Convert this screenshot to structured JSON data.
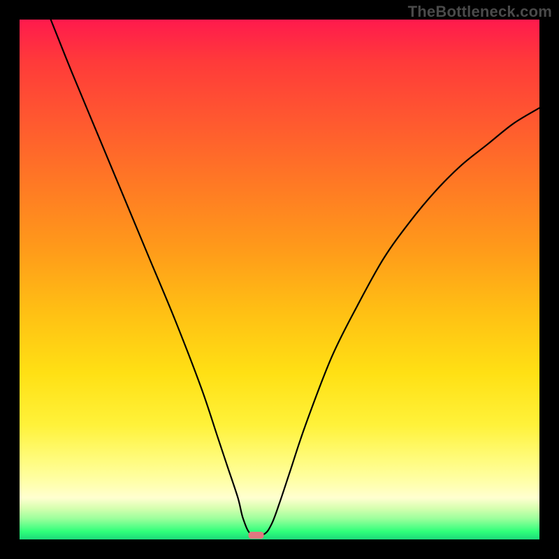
{
  "watermark": "TheBottleneck.com",
  "colors": {
    "frame_background": "#000000",
    "gradient_top": "#ff1a4d",
    "gradient_bottom": "#1dd97a",
    "curve": "#000000",
    "marker": "#e07880"
  },
  "chart_data": {
    "type": "line",
    "title": "",
    "xlabel": "",
    "ylabel": "",
    "xlim": [
      0,
      100
    ],
    "ylim": [
      0,
      100
    ],
    "grid": false,
    "series": [
      {
        "name": "bottleneck-curve",
        "x": [
          6,
          10,
          15,
          20,
          25,
          30,
          35,
          38,
          40,
          42,
          43,
          44.5,
          47,
          48.5,
          50,
          52,
          55,
          60,
          65,
          70,
          75,
          80,
          85,
          90,
          95,
          100
        ],
        "y": [
          100,
          90,
          78,
          66,
          54,
          42,
          29,
          20,
          14,
          8,
          4,
          1,
          1,
          3,
          7,
          13,
          22,
          35,
          45,
          54,
          61,
          67,
          72,
          76,
          80,
          83
        ]
      }
    ],
    "marker": {
      "x": 45.5,
      "y": 0.8,
      "shape": "rounded-rect"
    },
    "background_gradient": {
      "direction": "vertical",
      "stops": [
        {
          "pos": 0.0,
          "color": "#ff1a4d"
        },
        {
          "pos": 0.5,
          "color": "#ffbf14"
        },
        {
          "pos": 0.85,
          "color": "#fffc80"
        },
        {
          "pos": 0.96,
          "color": "#9cff9c"
        },
        {
          "pos": 1.0,
          "color": "#1dd97a"
        }
      ]
    }
  }
}
